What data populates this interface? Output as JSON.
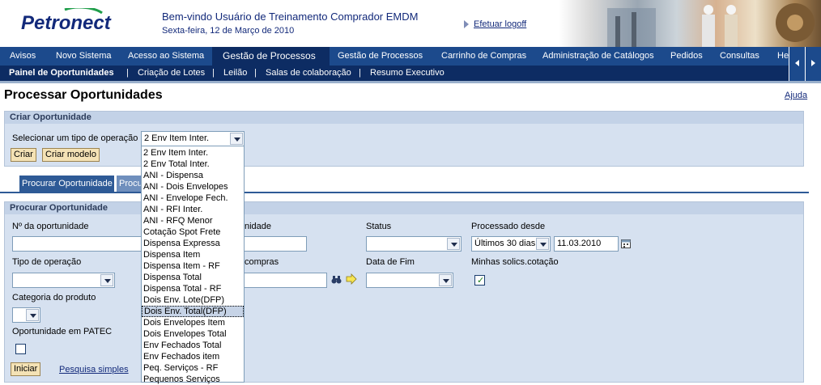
{
  "header": {
    "logo_text": "Petronect",
    "welcome": "Bem-vindo Usuário de Treinamento Comprador EMDM",
    "date": "Sexta-feira, 12 de Março de 2010",
    "logoff": "Efetuar logoff"
  },
  "nav_primary": [
    {
      "label": "Avisos"
    },
    {
      "label": "Novo Sistema"
    },
    {
      "label": "Acesso ao Sistema"
    },
    {
      "label": "Gestão de Processos"
    },
    {
      "label": "Gestão de Processos"
    },
    {
      "label": "Carrinho de Compras"
    },
    {
      "label": "Administração de Catálogos"
    },
    {
      "label": "Pedidos"
    },
    {
      "label": "Consultas"
    },
    {
      "label": "He"
    }
  ],
  "nav_secondary": [
    {
      "label": "Painel de Oportunidades"
    },
    {
      "label": "Criação de Lotes"
    },
    {
      "label": "Leilão"
    },
    {
      "label": "Salas de colaboração"
    },
    {
      "label": "Resumo Executivo"
    }
  ],
  "page": {
    "title": "Processar Oportunidades",
    "help": "Ajuda"
  },
  "criar": {
    "panel_title": "Criar Oportunidade",
    "select_label": "Selecionar um tipo de operação",
    "select_value": "2 Env Item Inter.",
    "btn_criar": "Criar",
    "btn_criar_modelo": "Criar modelo"
  },
  "tabs": [
    {
      "label": "Procurar Oportunidade"
    },
    {
      "label": "Procurar"
    }
  ],
  "procurar": {
    "panel_title": "Procurar Oportunidade",
    "labels": {
      "num": "Nº da oportunidade",
      "desc_tail": "nidade",
      "status": "Status",
      "processado": "Processado desde",
      "tipo": "Tipo de operação",
      "compras_tail": " compras",
      "data_fim": "Data de Fim",
      "minhas": "Minhas solics.cotação",
      "categoria": "Categoria do produto",
      "patec": "Oportunidade em PATEC"
    },
    "processado_periodo": "Últimos 30 dias",
    "processado_data": "11.03.2010",
    "minhas_checked": true,
    "btn_iniciar": "Iniciar",
    "link_pesquisa": "Pesquisa simples"
  },
  "dropdown_options": [
    "2 Env Item Inter.",
    "2 Env Total Inter.",
    "ANI - Dispensa",
    "ANI - Dois Envelopes",
    "ANI - Envelope Fech.",
    "ANI - RFI Inter.",
    "ANI - RFQ Menor",
    "Cotação Spot Frete",
    "Dispensa Expressa",
    "Dispensa Item",
    "Dispensa Item - RF",
    "Dispensa Total",
    "Dispensa Total - RF",
    "Dois Env. Lote(DFP)",
    "Dois Env. Total(DFP)",
    "Dois Envelopes Item",
    "Dois Envelopes Total",
    "Env Fechados Total",
    "Env Fechados item",
    "Peq. Serviços - RF",
    "Pequenos Serviços"
  ],
  "dropdown_selected": "Dois Env. Total(DFP)",
  "colors": {
    "nav_primary": "#1c4a8c",
    "nav_active": "#0d2c63",
    "panel_bg": "#d6e1f0",
    "button_bg": "#f4e2b5",
    "link": "#12297a"
  }
}
